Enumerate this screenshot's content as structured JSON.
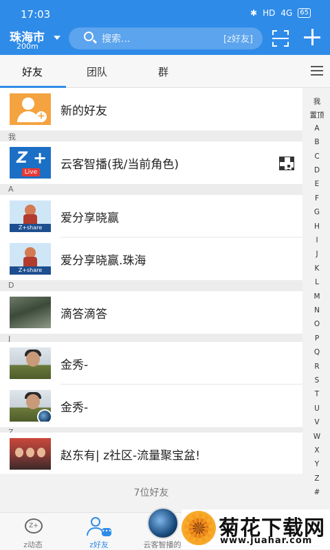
{
  "status": {
    "time": "17:03",
    "network": "HD",
    "signal": "4G",
    "battery": "65"
  },
  "header": {
    "city": "珠海市",
    "distance": "200m",
    "search_placeholder": "搜索...",
    "search_tag": "[z好友]"
  },
  "tabs": [
    {
      "label": "好友",
      "active": true
    },
    {
      "label": "团队",
      "active": false
    },
    {
      "label": "群",
      "active": false
    }
  ],
  "new_friend": {
    "label": "新的好友",
    "icon": "add-friend-icon"
  },
  "sections": {
    "me": "我",
    "a": "A",
    "d": "D",
    "j": "J",
    "z": "Z"
  },
  "contacts": [
    {
      "name": "云客智播(我/当前角色)",
      "avatar": "z-live-logo"
    },
    {
      "name": "爱分享晓赢",
      "avatar": "z-share-logo"
    },
    {
      "name": "爱分享晓赢.珠海",
      "avatar": "z-share-logo"
    },
    {
      "name": "滴答滴答",
      "avatar": "photo"
    },
    {
      "name": "金秀-",
      "avatar": "photo"
    },
    {
      "name": "金秀-",
      "avatar": "photo"
    },
    {
      "name": "赵东有| z社区-流量聚宝盆!",
      "avatar": "photo"
    }
  ],
  "avatar_text": {
    "live_z": "Z",
    "live_plus": "+",
    "live_badge": "Live",
    "share_bar": "Z+share"
  },
  "friend_count": "7位好友",
  "index_bar": [
    "我",
    "置顶",
    "A",
    "B",
    "C",
    "D",
    "E",
    "F",
    "G",
    "H",
    "I",
    "J",
    "K",
    "L",
    "M",
    "N",
    "O",
    "P",
    "Q",
    "R",
    "S",
    "T",
    "U",
    "V",
    "W",
    "X",
    "Y",
    "Z",
    "#"
  ],
  "bottom_nav": [
    {
      "label": "z动态",
      "icon": "z-bubble-icon",
      "glyph": "Z+"
    },
    {
      "label": "z好友",
      "icon": "friends-icon",
      "active": true
    },
    {
      "label": "云客智播的",
      "icon": "globe-icon"
    }
  ],
  "watermark": {
    "title": "菊花下载网",
    "url": "www.juahar.com"
  },
  "colors": {
    "primary": "#2f8be8",
    "new_friend": "#f4a340",
    "background": "#f2f2f2"
  }
}
